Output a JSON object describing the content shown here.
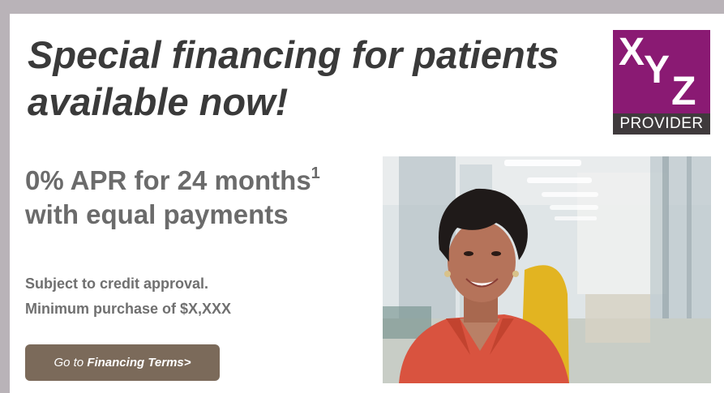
{
  "headline": {
    "line1": "Special financing for patients",
    "line2": "available now!"
  },
  "logo": {
    "letters": [
      "X",
      "Y",
      "Z"
    ],
    "subtitle": "PROVIDER",
    "colors": {
      "top": "#8a1a73",
      "bottom": "#3f3a3c"
    }
  },
  "offer": {
    "line1": "0% APR for 24 months",
    "footnote": "1",
    "line2": "with equal payments"
  },
  "fine_print": {
    "line1": "Subject to credit approval.",
    "line2": "Minimum purchase of $X,XXX"
  },
  "cta": {
    "prefix": "Go to ",
    "label": "Financing Terms>",
    "color": "#7b6a5a"
  },
  "photo": {
    "icon": "patient-photo"
  }
}
